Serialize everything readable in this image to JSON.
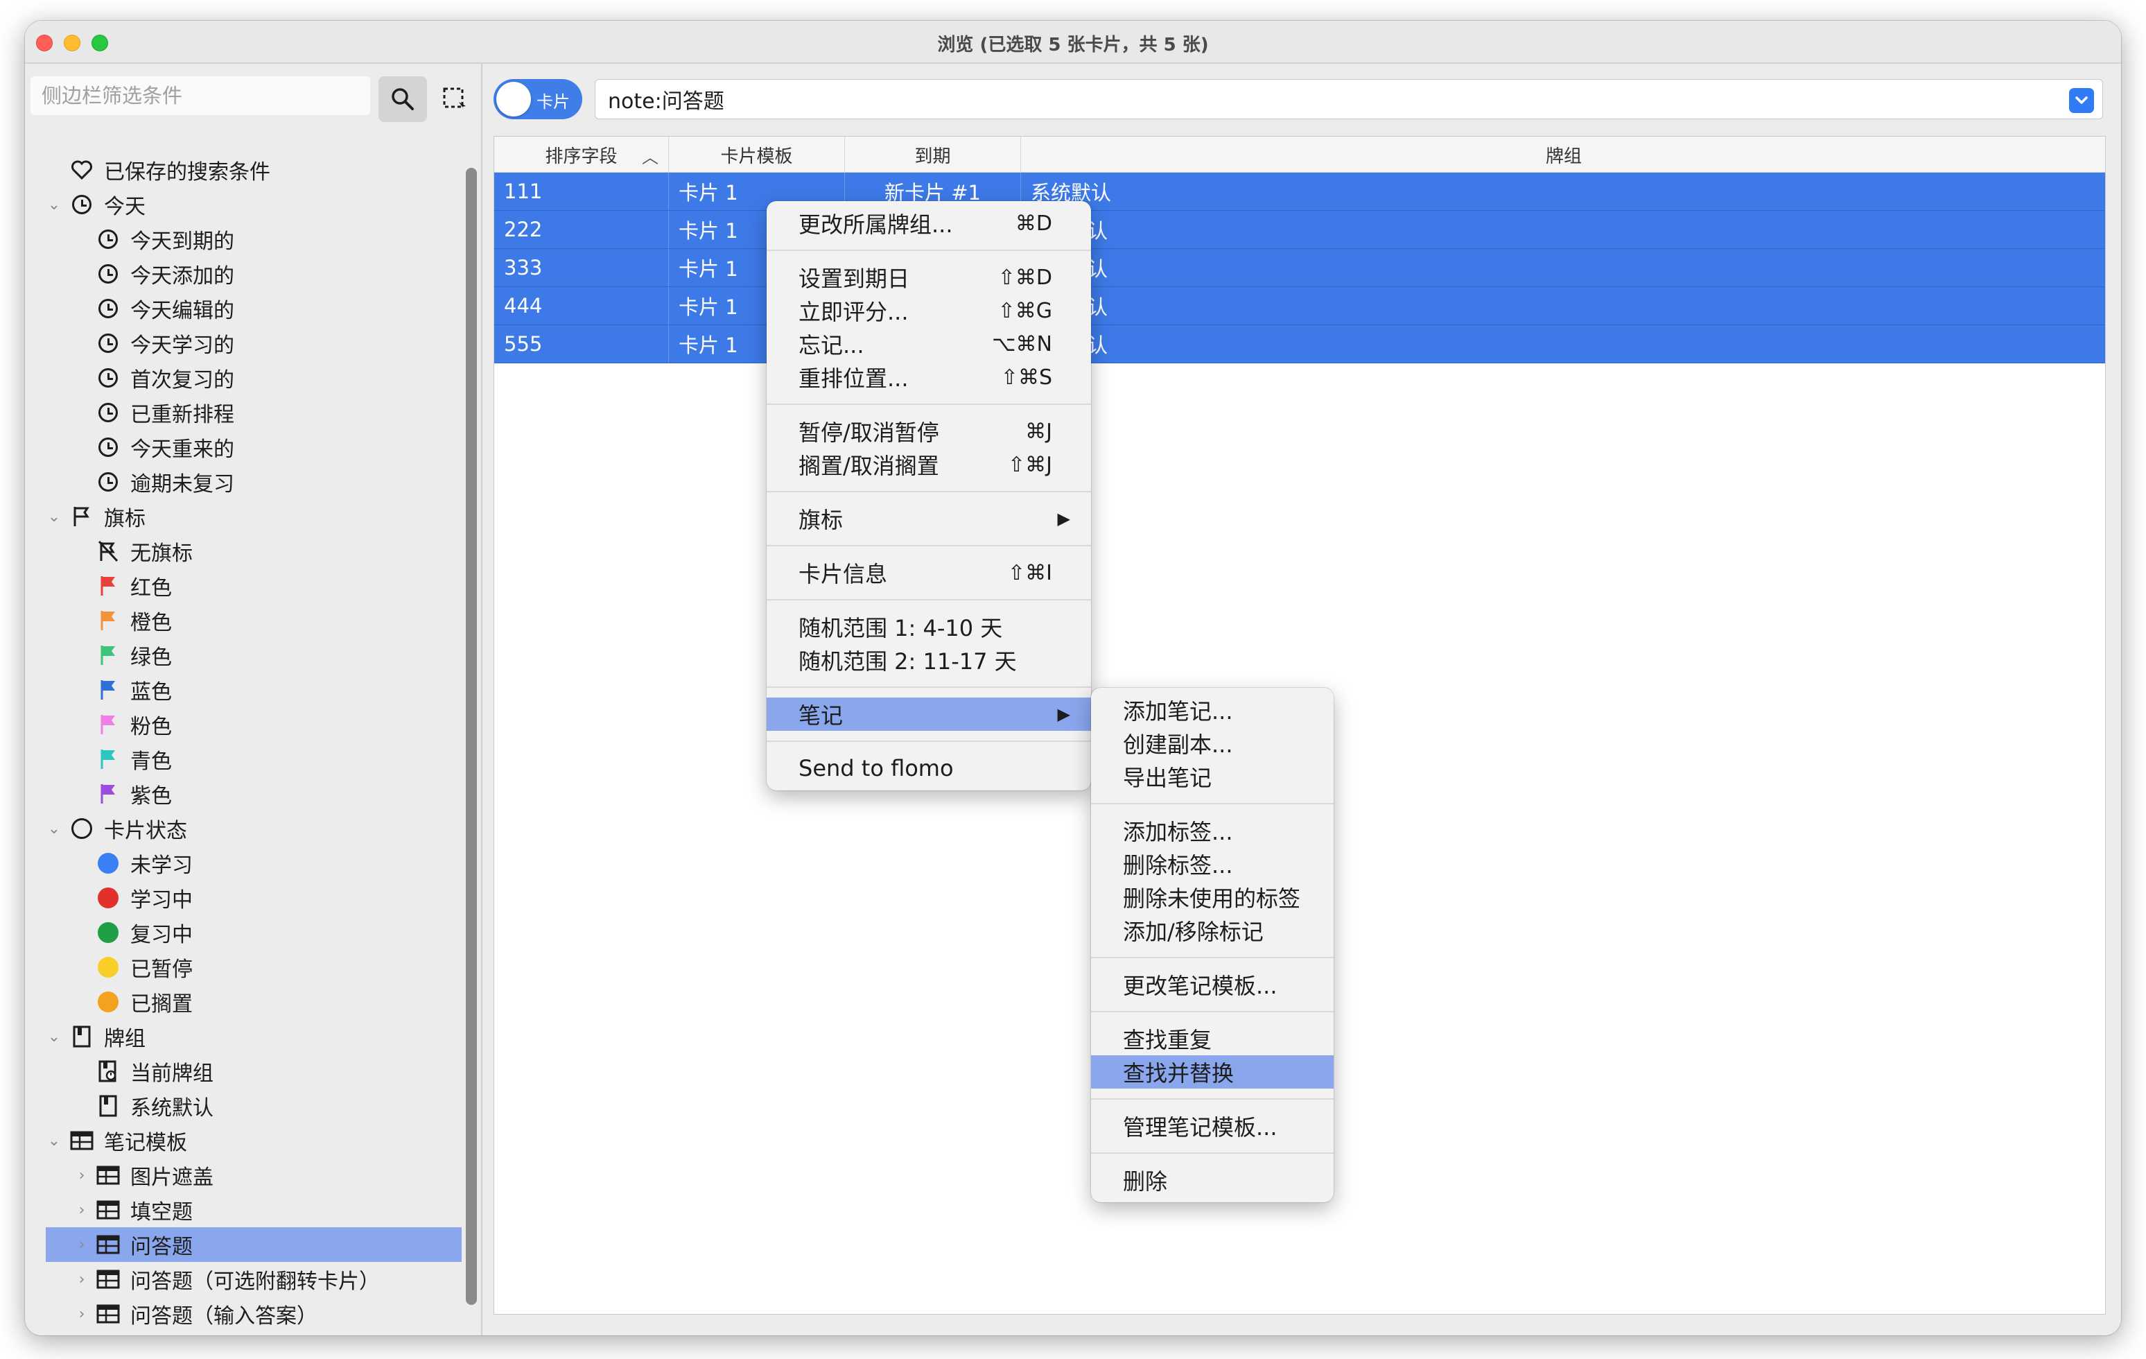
{
  "window": {
    "title": "浏览 (已选取 5 张卡片，共 5 张)"
  },
  "sidebar": {
    "search_placeholder": "侧边栏筛选条件",
    "items": [
      {
        "label": "已保存的搜索条件",
        "icon": "heart-icon"
      },
      {
        "label": "今天",
        "icon": "clock-icon"
      },
      {
        "label": "今天到期的",
        "icon": "clock-icon"
      },
      {
        "label": "今天添加的",
        "icon": "clock-icon"
      },
      {
        "label": "今天编辑的",
        "icon": "clock-icon"
      },
      {
        "label": "今天学习的",
        "icon": "clock-icon"
      },
      {
        "label": "首次复习的",
        "icon": "clock-icon"
      },
      {
        "label": "已重新排程",
        "icon": "clock-icon"
      },
      {
        "label": "今天重来的",
        "icon": "clock-icon"
      },
      {
        "label": "逾期未复习",
        "icon": "clock-icon"
      },
      {
        "label": "旗标",
        "icon": "flag-outline-icon"
      },
      {
        "label": "无旗标",
        "icon": "no-flag-icon"
      },
      {
        "label": "红色",
        "icon": "flag-icon",
        "color": "#e8413a"
      },
      {
        "label": "橙色",
        "icon": "flag-icon",
        "color": "#f4923c"
      },
      {
        "label": "绿色",
        "icon": "flag-icon",
        "color": "#3bc47a"
      },
      {
        "label": "蓝色",
        "icon": "flag-icon",
        "color": "#2f6fd8"
      },
      {
        "label": "粉色",
        "icon": "flag-icon",
        "color": "#ef7ee6"
      },
      {
        "label": "青色",
        "icon": "flag-icon",
        "color": "#2cc6be"
      },
      {
        "label": "紫色",
        "icon": "flag-icon",
        "color": "#9a4de0"
      },
      {
        "label": "卡片状态",
        "icon": "circle-icon"
      },
      {
        "label": "未学习",
        "icon": "dot-icon",
        "color": "#3b7ff5"
      },
      {
        "label": "学习中",
        "icon": "dot-icon",
        "color": "#e2312b"
      },
      {
        "label": "复习中",
        "icon": "dot-icon",
        "color": "#1f9e45"
      },
      {
        "label": "已暂停",
        "icon": "dot-icon",
        "color": "#f8cf2a"
      },
      {
        "label": "已搁置",
        "icon": "dot-icon",
        "color": "#f3a21e"
      },
      {
        "label": "牌组",
        "icon": "deck-icon"
      },
      {
        "label": "当前牌组",
        "icon": "current-deck-icon"
      },
      {
        "label": "系统默认",
        "icon": "deck-icon"
      },
      {
        "label": "笔记模板",
        "icon": "notetype-icon"
      },
      {
        "label": "图片遮盖",
        "icon": "notetype-icon"
      },
      {
        "label": "填空题",
        "icon": "notetype-icon"
      },
      {
        "label": "问答题",
        "icon": "notetype-icon"
      },
      {
        "label": "问答题（可选附翻转卡片）",
        "icon": "notetype-icon"
      },
      {
        "label": "问答题（输入答案）",
        "icon": "notetype-icon"
      }
    ]
  },
  "toolbar": {
    "toggle_label": "卡片",
    "query": "note:问答题"
  },
  "table": {
    "columns": [
      "排序字段",
      "卡片模板",
      "到期",
      "牌组"
    ],
    "rows": [
      [
        "111",
        "卡片 1",
        "新卡片 #1",
        "系统默认"
      ],
      [
        "222",
        "卡片 1",
        "",
        "认"
      ],
      [
        "333",
        "卡片 1",
        "",
        "认"
      ],
      [
        "444",
        "卡片 1",
        "",
        "认"
      ],
      [
        "555",
        "卡片 1",
        "",
        "认"
      ]
    ]
  },
  "context_menu": {
    "items": [
      {
        "label": "更改所属牌组...",
        "shortcut": "⌘D"
      },
      {
        "label": "设置到期日",
        "shortcut": "⇧⌘D"
      },
      {
        "label": "立即评分...",
        "shortcut": "⇧⌘G"
      },
      {
        "label": "忘记...",
        "shortcut": "⌥⌘N"
      },
      {
        "label": "重排位置...",
        "shortcut": "⇧⌘S"
      },
      {
        "label": "暂停/取消暂停",
        "shortcut": "⌘J"
      },
      {
        "label": "搁置/取消搁置",
        "shortcut": "⇧⌘J"
      },
      {
        "label": "旗标",
        "arrow": "▶"
      },
      {
        "label": "卡片信息",
        "shortcut": "⇧⌘I"
      },
      {
        "label": "随机范围 1: 4-10 天"
      },
      {
        "label": "随机范围 2: 11-17 天"
      },
      {
        "label": "笔记",
        "arrow": "▶"
      },
      {
        "label": "Send to flomo"
      }
    ]
  },
  "submenu": {
    "items": [
      "添加笔记...",
      "创建副本...",
      "导出笔记",
      "添加标签...",
      "删除标签...",
      "删除未使用的标签",
      "添加/移除标记",
      "更改笔记模板...",
      "查找重复",
      "查找并替换",
      "管理笔记模板...",
      "删除"
    ]
  },
  "colors": {
    "accent": "#3d7ae8",
    "highlight": "#8aa7ee"
  }
}
